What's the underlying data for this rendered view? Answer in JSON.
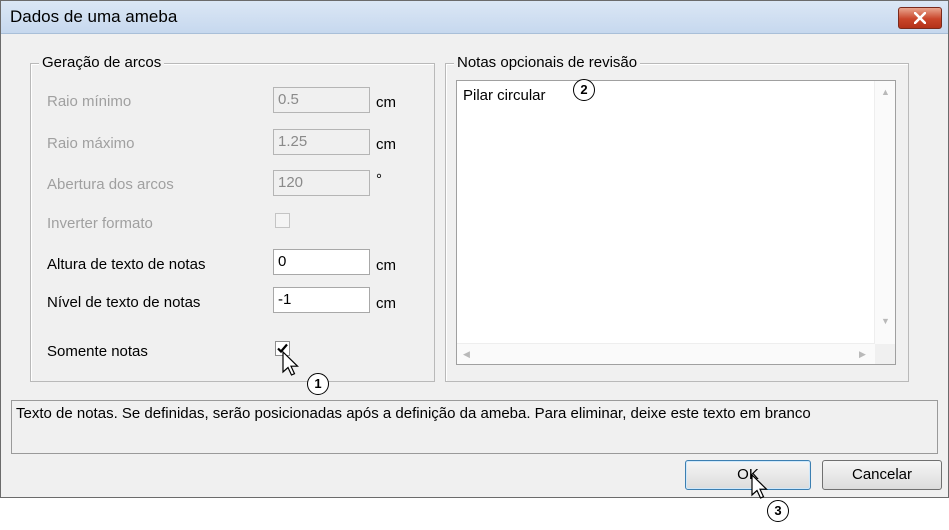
{
  "window": {
    "title": "Dados de uma ameba"
  },
  "arc_group": {
    "legend": "Geração de arcos",
    "min_radius": {
      "label": "Raio mínimo",
      "value": "0.5",
      "unit": "cm"
    },
    "max_radius": {
      "label": "Raio máximo",
      "value": "1.25",
      "unit": "cm"
    },
    "arc_opening": {
      "label": "Abertura dos arcos",
      "value": "120",
      "unit": "°"
    },
    "invert_format": {
      "label": "Inverter formato",
      "checked": false
    },
    "notes_text_height": {
      "label": "Altura de texto de notas",
      "value": "0",
      "unit": "cm"
    },
    "notes_text_level": {
      "label": "Nível de texto de notas",
      "value": "-1",
      "unit": "cm"
    },
    "only_notes": {
      "label": "Somente notas",
      "checked": true
    }
  },
  "notes_group": {
    "legend": "Notas opcionais de revisão",
    "text": "Pilar circular"
  },
  "status": {
    "text": "Texto de notas. Se definidas, serão posicionadas após a definição da ameba. Para eliminar, deixe este texto em branco"
  },
  "buttons": {
    "ok": "OK",
    "cancel": "Cancelar"
  },
  "callouts": [
    "1",
    "2",
    "3"
  ]
}
